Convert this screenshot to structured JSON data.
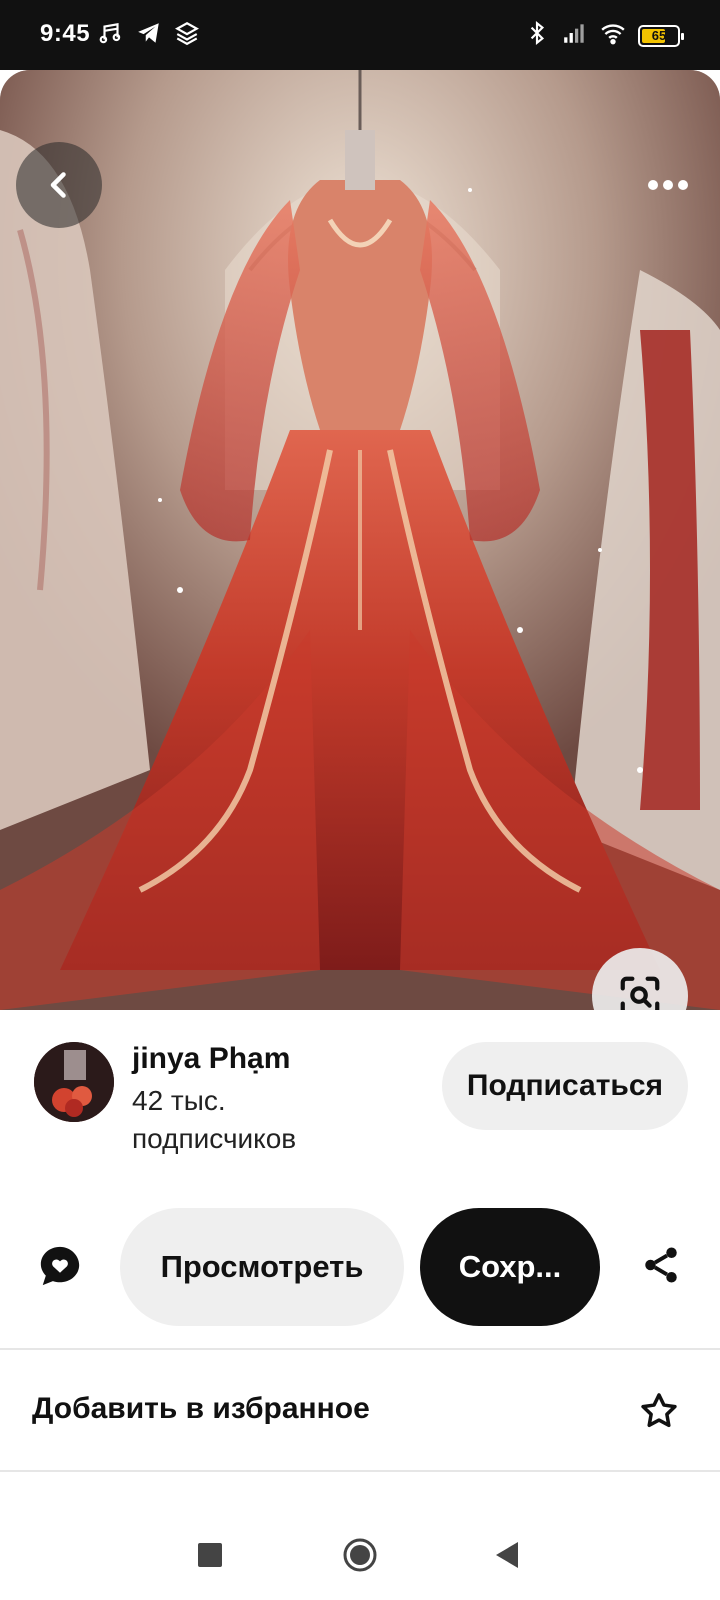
{
  "status_bar": {
    "time": "9:45",
    "battery_level": "65",
    "battery_fraction": 0.65,
    "left_icons": [
      "music-note-icon",
      "telegram-icon",
      "layers-icon"
    ],
    "right_icons": [
      "bluetooth-icon",
      "signal-icon",
      "wifi-icon",
      "battery-icon"
    ]
  },
  "image": {
    "subject": "red-embroidered-gown",
    "overlay_buttons": [
      "back-arrow-icon",
      "more-dots-icon",
      "visual-search-icon"
    ]
  },
  "creator": {
    "name": "jinya Phạm",
    "followers_line1": "42 тыс.",
    "followers_line2": "подписчиков",
    "subscribe_label": "Подписаться"
  },
  "actions": {
    "comment_icon": "comment-heart-icon",
    "view_label": "Просмотреть",
    "save_label": "Сохр...",
    "share_icon": "share-icon"
  },
  "favorites": {
    "label": "Добавить в избранное",
    "icon": "star-outline-icon"
  },
  "nav": {
    "icons": [
      "recent-apps-icon",
      "home-icon",
      "back-icon"
    ]
  },
  "colors": {
    "primary_dark": "#111111",
    "pill_light": "#efefef",
    "divider": "#e6e6e6",
    "gown_red": "#c0392b"
  }
}
